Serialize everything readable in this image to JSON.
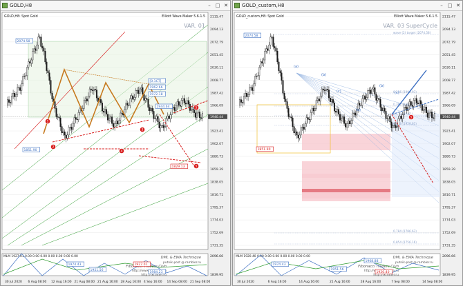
{
  "windows": [
    {
      "title": "GOLD,H8",
      "symbol_line": "GOLD,H8:  Spot Gold",
      "wave_maker": "Elliott Wave Maker 5.6.1.5",
      "variant_label": "VAR. 01",
      "price_labels": [
        "2115.47",
        "2094.13",
        "2072.79",
        "2051.45",
        "2030.11",
        "2008.77",
        "1987.42",
        "1966.09",
        "1944.75",
        "1923.41",
        "1902.07",
        "1880.73",
        "1859.39",
        "1838.05",
        "1816.71",
        "1795.37",
        "1774.03",
        "1752.69",
        "1731.35"
      ],
      "point_tags": [
        "2074.58",
        "1962.66",
        "1972.18",
        "1944.64",
        "1851.90",
        "1829.13",
        "[0.1CT]"
      ],
      "wave_numbers": [
        "1",
        "2",
        "3",
        "4",
        "5",
        "5"
      ],
      "current_price": "1940.44",
      "osc_label": "MLM 1927.01 0.00 0.00 0.00 0.00 0.00 0.00 0.00",
      "osc_tags": [
        "1974.43",
        "1951.56",
        "1927.01",
        "1984.23"
      ],
      "osc_right_labels": [
        "2096.66",
        "1839.95"
      ],
      "watermark": [
        "DML & EWA Technique",
        "putnik-post @ rambler.ru",
        "Fibonacci  Traders  Club",
        "http://www.dml-ewa.ru",
        "http://fxtrader.ru"
      ],
      "time_labels": [
        "30 Jul 2020",
        "6 Aug 08:00",
        "12 Aug 16:00",
        "21 Aug 08:00",
        "21 Aug 16:00",
        "28 Aug 16:00",
        "4 Sep 16:00",
        "14 Sep 08:00",
        "21 Sep 08:00"
      ]
    },
    {
      "title": "GOLD_custom,H8",
      "symbol_line": "GOLD_custom,H8:  Spot Gold",
      "wave_maker": "Elliott Wave Maker 5.6.1.5",
      "variant_label": "VAR. 03  SuperCycle",
      "price_labels": [
        "2115.47",
        "2094.13",
        "2072.79",
        "2051.45",
        "2030.11",
        "2008.77",
        "1987.42",
        "1966.09",
        "1944.75",
        "1923.41",
        "1902.07",
        "1880.73",
        "1859.39",
        "1838.05",
        "1816.71",
        "1795.37",
        "1774.03",
        "1752.69",
        "1731.35"
      ],
      "point_tags": [
        "2074.58",
        "1851.90"
      ],
      "fib_labels": [
        "wave (2) target (2074.58)",
        "0.236 (1990.93)",
        "0.382 (1966.57)",
        "0.5 (1947.61)",
        "0.618 (1920.61)",
        "0.784 (1786.63)",
        "0.854 (1756.16)"
      ],
      "wave_letters": [
        "(a)",
        "(b)",
        "(c)",
        "(a)",
        "(b)",
        "(c)"
      ],
      "wave_numbers": [
        "5"
      ],
      "current_price": "1940.44",
      "osc_label": "MLM 1920.40 0.00 0.00 0.00 0.00 0.00 0.00 0.00",
      "osc_tags": [
        "1974.43",
        "1968.88",
        "1951.56",
        "1920.40"
      ],
      "osc_right_labels": [
        "2096.66",
        "1839.95"
      ],
      "watermark": [
        "DML & EWA Technique",
        "putnik-post @ rambler.ru",
        "Fibonacci  Traders  Club",
        "http://www.dml-ewa.ru",
        "http://fxtrader.ru"
      ],
      "time_labels": [
        "30 Jul 2020",
        "6 Aug 16:00",
        "14 Aug 16:00",
        "21 Aug 16:00",
        "28 Aug 16:00",
        "7 Sep 08:00",
        "14 Sep 08:00"
      ]
    }
  ],
  "colors": {
    "chart_bg": "#ffffff",
    "grid": "#e2e2e2",
    "candle": "#1a1a1a",
    "green_fan": "#2e9b2e",
    "red_line": "#d81f1f",
    "orange_wave": "#c77a1f",
    "blue_wave": "#3c6fc2",
    "pink_zone": "#f8c9cf",
    "yellow_box": "#f2c02e"
  }
}
